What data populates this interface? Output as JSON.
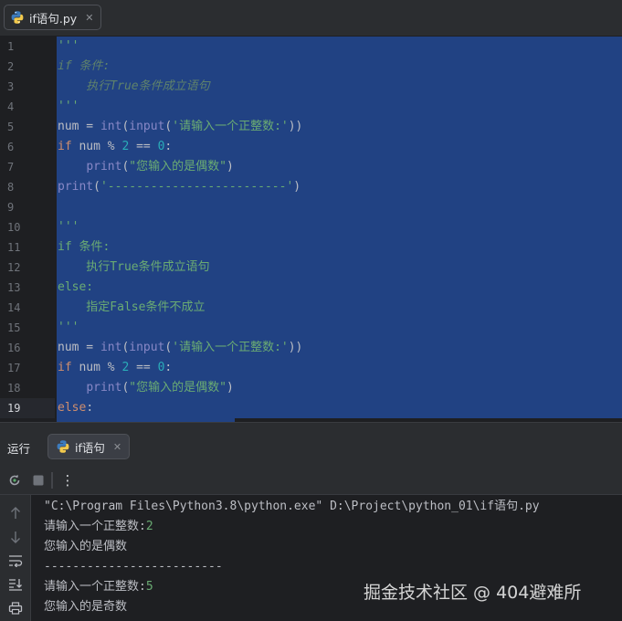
{
  "editor_tab": {
    "filename": "if语句.py",
    "close": "✕"
  },
  "editor": {
    "line_numbers": [
      "1",
      "2",
      "3",
      "4",
      "5",
      "6",
      "7",
      "8",
      "9",
      "10",
      "11",
      "12",
      "13",
      "14",
      "15",
      "16",
      "17",
      "18",
      "19"
    ],
    "current_line": 19,
    "lines": [
      [
        {
          "t": "'''",
          "c": "doc"
        }
      ],
      [
        {
          "t": "if 条件:",
          "c": "doc-i"
        }
      ],
      [
        {
          "t": "    执行True条件成立语句",
          "c": "doc-i"
        }
      ],
      [
        {
          "t": "'''",
          "c": "doc"
        }
      ],
      [
        {
          "t": "num = ",
          "c": "plain"
        },
        {
          "t": "int",
          "c": "builtin"
        },
        {
          "t": "(",
          "c": "plain"
        },
        {
          "t": "input",
          "c": "builtin"
        },
        {
          "t": "(",
          "c": "plain"
        },
        {
          "t": "'请输入一个正整数:'",
          "c": "str"
        },
        {
          "t": "))",
          "c": "plain"
        }
      ],
      [
        {
          "t": "if",
          "c": "kw"
        },
        {
          "t": " num % ",
          "c": "plain"
        },
        {
          "t": "2",
          "c": "num"
        },
        {
          "t": " == ",
          "c": "plain"
        },
        {
          "t": "0",
          "c": "num"
        },
        {
          "t": ":",
          "c": "plain"
        }
      ],
      [
        {
          "t": "    ",
          "c": "plain"
        },
        {
          "t": "print",
          "c": "builtin"
        },
        {
          "t": "(",
          "c": "plain"
        },
        {
          "t": "\"您输入的是偶数\"",
          "c": "str"
        },
        {
          "t": ")",
          "c": "plain"
        }
      ],
      [
        {
          "t": "print",
          "c": "builtin"
        },
        {
          "t": "(",
          "c": "plain"
        },
        {
          "t": "'-------------------------'",
          "c": "str"
        },
        {
          "t": ")",
          "c": "plain"
        }
      ],
      [],
      [
        {
          "t": "'''",
          "c": "doc"
        }
      ],
      [
        {
          "t": "if 条件:",
          "c": "doc"
        }
      ],
      [
        {
          "t": "    执行True条件成立语句",
          "c": "doc"
        }
      ],
      [
        {
          "t": "else:",
          "c": "doc"
        }
      ],
      [
        {
          "t": "    指定False条件不成立",
          "c": "doc"
        }
      ],
      [
        {
          "t": "'''",
          "c": "doc"
        }
      ],
      [
        {
          "t": "num = ",
          "c": "plain"
        },
        {
          "t": "int",
          "c": "builtin"
        },
        {
          "t": "(",
          "c": "plain"
        },
        {
          "t": "input",
          "c": "builtin"
        },
        {
          "t": "(",
          "c": "plain"
        },
        {
          "t": "'请输入一个正整数:'",
          "c": "str"
        },
        {
          "t": "))",
          "c": "plain"
        }
      ],
      [
        {
          "t": "if",
          "c": "kw"
        },
        {
          "t": " num % ",
          "c": "plain"
        },
        {
          "t": "2",
          "c": "num"
        },
        {
          "t": " == ",
          "c": "plain"
        },
        {
          "t": "0",
          "c": "num"
        },
        {
          "t": ":",
          "c": "plain"
        }
      ],
      [
        {
          "t": "    ",
          "c": "plain"
        },
        {
          "t": "print",
          "c": "builtin"
        },
        {
          "t": "(",
          "c": "plain"
        },
        {
          "t": "\"您输入的是偶数\"",
          "c": "str"
        },
        {
          "t": ")",
          "c": "plain"
        }
      ],
      [
        {
          "t": "else",
          "c": "kw"
        },
        {
          "t": ":",
          "c": "plain"
        }
      ]
    ]
  },
  "run_panel": {
    "title": "运行",
    "tab_label": "if语句",
    "tab_close": "✕",
    "more_label": "⋮",
    "output": [
      [
        {
          "t": "\"C:\\Program Files\\Python3.8\\python.exe\" D:\\Project\\python_01\\if语句.py",
          "c": ""
        }
      ],
      [
        {
          "t": "请输入一个正整数:",
          "c": ""
        },
        {
          "t": "2",
          "c": "out-input"
        }
      ],
      [
        {
          "t": "您输入的是偶数",
          "c": ""
        }
      ],
      [
        {
          "t": "-------------------------",
          "c": ""
        }
      ],
      [
        {
          "t": "请输入一个正整数:",
          "c": ""
        },
        {
          "t": "5",
          "c": "out-input"
        }
      ],
      [
        {
          "t": "您输入的是奇数",
          "c": ""
        }
      ]
    ]
  },
  "watermark": "掘金技术社区 @ 404避难所",
  "colors": {
    "selection": "#214283",
    "keyword": "#cf8e6d",
    "string": "#6aab73",
    "number": "#2aacb8",
    "builtin": "#8888c6",
    "background": "#1e1f22"
  },
  "icons": {
    "file_type": "python-icon",
    "rerun": "rerun-icon",
    "stop": "stop-icon",
    "more": "more-vertical-icon",
    "up": "arrow-up-icon",
    "down": "arrow-down-icon",
    "wrap": "soft-wrap-icon",
    "scroll_end": "scroll-to-end-icon",
    "print": "print-icon"
  }
}
